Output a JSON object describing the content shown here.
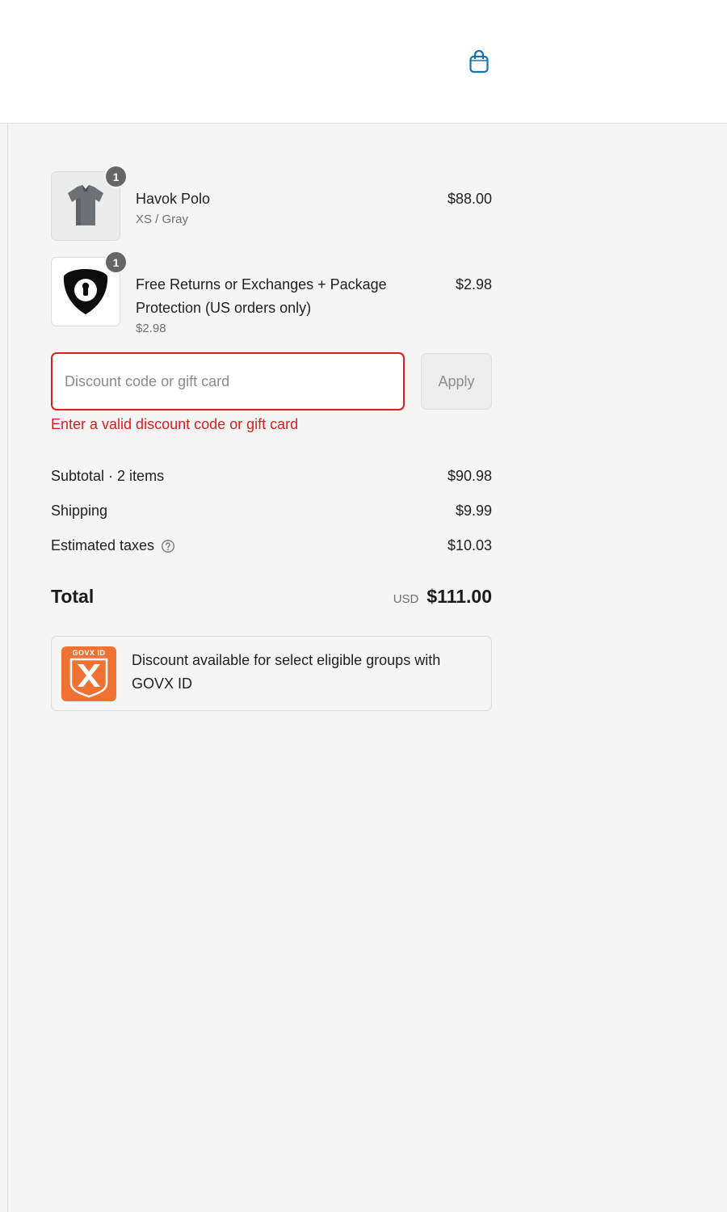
{
  "header": {
    "cart_icon": "shopping-bag-icon",
    "accent": "#1773b0"
  },
  "items": [
    {
      "name": "Havok Polo",
      "variant": "XS / Gray",
      "price": "$88.00",
      "quantity": "1",
      "thumb_icon": "polo-shirt-image"
    },
    {
      "name": "Free Returns or Exchanges + Package Protection (US orders only)",
      "unit_price": "$2.98",
      "price": "$2.98",
      "quantity": "1",
      "thumb_icon": "shield-lock-icon"
    }
  ],
  "discount": {
    "placeholder": "Discount code or gift card",
    "value": "",
    "apply_label": "Apply",
    "error": "Enter a valid discount code or gift card",
    "error_color": "#dd1d1d"
  },
  "totals": {
    "subtotal_label": "Subtotal · 2 items",
    "subtotal_value": "$90.98",
    "shipping_label": "Shipping",
    "shipping_value": "$9.99",
    "taxes_label": "Estimated taxes",
    "taxes_value": "$10.03",
    "total_label": "Total",
    "currency": "USD",
    "total_value": "$111.00"
  },
  "govx": {
    "logo_text": "GOVX ID",
    "message": "Discount available for select eligible groups with GOVX ID",
    "logo_color": "#f07131"
  }
}
